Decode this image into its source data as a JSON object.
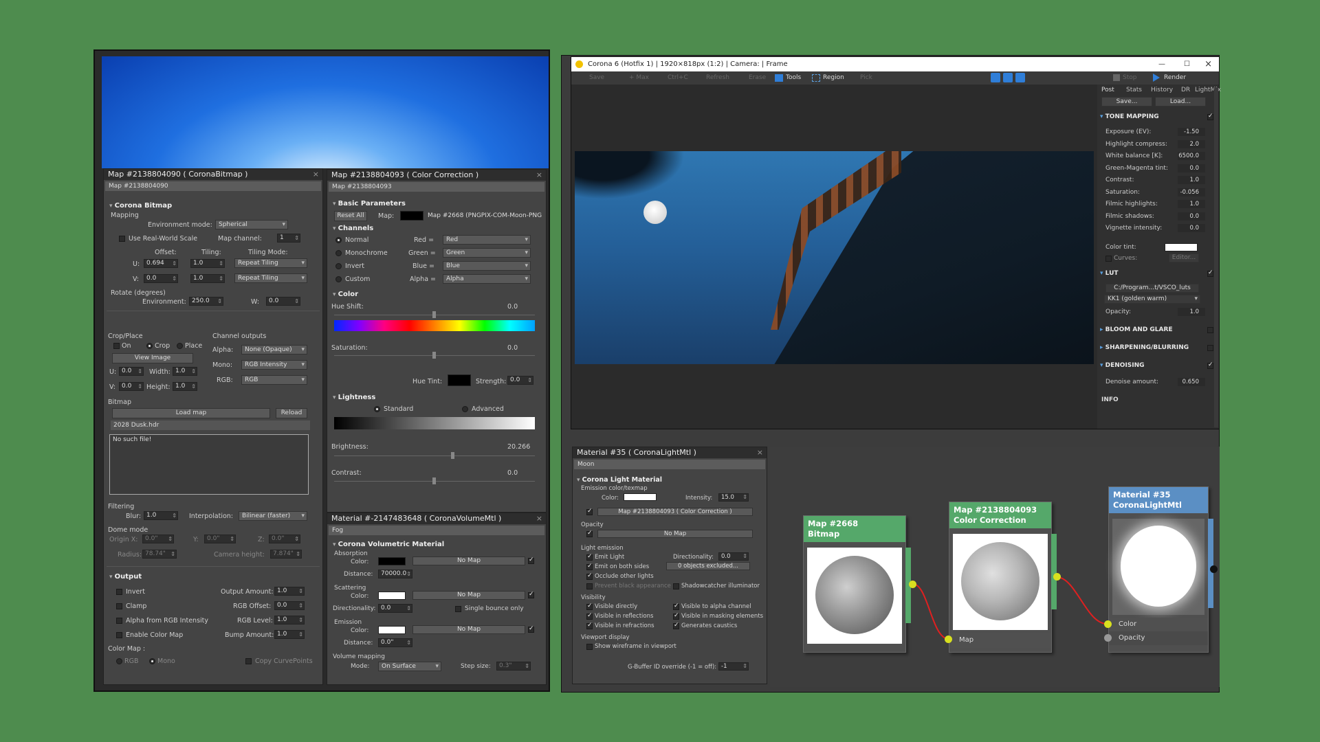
{
  "bitmap_panel": {
    "title": "Map #2138804090  ( CoronaBitmap )",
    "name": "Map #2138804090",
    "section": "Corona Bitmap",
    "mapping_label": "Mapping",
    "env_mode_label": "Environment mode:",
    "env_mode": "Spherical",
    "real_world": "Use Real-World Scale",
    "map_channel_label": "Map channel:",
    "map_channel": "1",
    "offset_label": "Offset:",
    "tiling_label": "Tiling:",
    "tiling_mode_label": "Tiling Mode:",
    "u_label": "U:",
    "u_offset": "0.694",
    "u_tiling": "1.0",
    "u_mode": "Repeat Tiling",
    "v_label": "V:",
    "v_offset": "0.0",
    "v_tiling": "1.0",
    "v_mode": "Repeat Tiling",
    "rotate_label": "Rotate (degrees)",
    "environment_label": "Environment:",
    "environment_val": "250.0",
    "w_label": "W:",
    "w_val": "0.0",
    "crop_label": "Crop/Place",
    "on_label": "On",
    "crop": "Crop",
    "place": "Place",
    "view_image": "View Image",
    "cu_label": "U:",
    "cu": "0.0",
    "width_label": "Width:",
    "width": "1.0",
    "cv_label": "V:",
    "cv": "0.0",
    "height_label": "Height:",
    "height": "1.0",
    "channel_outputs": "Channel outputs",
    "alpha_label": "Alpha:",
    "alpha": "None (Opaque)",
    "mono_label": "Mono:",
    "mono": "RGB Intensity",
    "rgb_label": "RGB:",
    "rgb": "RGB",
    "bitmap_label": "Bitmap",
    "load_map": "Load map",
    "reload": "Reload",
    "file": "2028 Dusk.hdr",
    "no_file": "No such file!",
    "filtering": "Filtering",
    "blur_label": "Blur:",
    "blur": "1.0",
    "interp_label": "Interpolation:",
    "interp": "Bilinear (faster)",
    "dome_label": "Dome mode",
    "origin_label": "Origin X:",
    "origin_x": "0.0\"",
    "y_label": "Y:",
    "origin_y": "0.0\"",
    "z_label": "Z:",
    "origin_z": "0.0\"",
    "radius_label": "Radius:",
    "radius": "78.74\"",
    "cam_label": "Camera height:",
    "cam": "7.874\"",
    "output_section": "Output",
    "invert": "Invert",
    "clamp": "Clamp",
    "alpha_rgb": "Alpha from RGB Intensity",
    "enable_color": "Enable Color Map",
    "out_amount_label": "Output Amount:",
    "out_amount": "1.0",
    "rgb_offset_label": "RGB Offset:",
    "rgb_offset": "0.0",
    "rgb_level_label": "RGB Level:",
    "rgb_level": "1.0",
    "bump_label": "Bump Amount:",
    "bump": "1.0",
    "color_map_label": "Color Map :",
    "rgb_radio": "RGB",
    "mono_radio": "Mono",
    "copy_curve": "Copy CurvePoints"
  },
  "cc_panel": {
    "title": "Map #2138804093  ( Color Correction )",
    "name": "Map #2138804093",
    "basic": "Basic Parameters",
    "reset": "Reset All",
    "map_label": "Map:",
    "map_name": "Map #2668 (PNGPIX-COM-Moon-PNG",
    "channels": "Channels",
    "normal": "Normal",
    "monochrome": "Monochrome",
    "invert": "Invert",
    "custom": "Custom",
    "red_label": "Red =",
    "red": "Red",
    "green_label": "Green =",
    "green": "Green",
    "blue_label": "Blue =",
    "blue": "Blue",
    "alpha_label": "Alpha =",
    "alpha": "Alpha",
    "color": "Color",
    "hue_shift": "Hue Shift:",
    "hue_val": "0.0",
    "saturation": "Saturation:",
    "sat_val": "0.0",
    "hue_tint": "Hue Tint:",
    "strength_label": "Strength:",
    "strength": "0.0",
    "lightness": "Lightness",
    "standard": "Standard",
    "advanced": "Advanced",
    "brightness": "Brightness:",
    "bright_val": "20.266",
    "contrast": "Contrast:",
    "contrast_val": "0.0"
  },
  "vol_panel": {
    "title": "Material #-2147483648  ( CoronaVolumeMtl )",
    "name": "Fog",
    "section": "Corona Volumetric Material",
    "absorption": "Absorption",
    "color_label": "Color:",
    "no_map": "No Map",
    "distance_label": "Distance:",
    "abs_distance": "70000.0",
    "scattering": "Scattering",
    "directionality_label": "Directionality:",
    "directionality": "0.0",
    "single_bounce": "Single bounce only",
    "emission": "Emission",
    "em_distance": "0.0\"",
    "volume_mapping": "Volume mapping",
    "mode_label": "Mode:",
    "mode": "On Surface",
    "step_label": "Step size:",
    "step": "0.3\""
  },
  "vfb": {
    "title": "Corona 6 (Hotfix 1) | 1920×818px (1:2) | Camera: | Frame",
    "toolbar": [
      "Save",
      "+ Max",
      "Ctrl+C",
      "Refresh",
      "Erase",
      "Tools",
      "Region",
      "Pick"
    ],
    "stop": "Stop",
    "render": "Render",
    "tabs": [
      "Post",
      "Stats",
      "History",
      "DR",
      "LightMix"
    ],
    "save": "Save...",
    "load": "Load...",
    "tone_mapping": "TONE MAPPING",
    "tm_rows": [
      {
        "label": "Exposure (EV):",
        "value": "-1.50"
      },
      {
        "label": "Highlight compress:",
        "value": "2.0"
      },
      {
        "label": "White balance [K]:",
        "value": "6500.0"
      },
      {
        "label": "Green-Magenta tint:",
        "value": "0.0"
      },
      {
        "label": "Contrast:",
        "value": "1.0"
      },
      {
        "label": "Saturation:",
        "value": "-0.056"
      },
      {
        "label": "Filmic highlights:",
        "value": "1.0"
      },
      {
        "label": "Filmic shadows:",
        "value": "0.0"
      },
      {
        "label": "Vignette intensity:",
        "value": "0.0"
      }
    ],
    "color_tint": "Color tint:",
    "curves": "Curves:",
    "editor": "Editor...",
    "lut": "LUT",
    "lut_path": "C:/Program...t/VSCO_luts",
    "lut_name": "KK1 (golden warm)",
    "opacity_label": "Opacity:",
    "opacity": "1.0",
    "bloom": "BLOOM AND GLARE",
    "sharpen": "SHARPENING/BLURRING",
    "denoise": "DENOISING",
    "denoise_label": "Denoise amount:",
    "denoise_val": "0.650",
    "info": "INFO"
  },
  "light_panel": {
    "title": "Material #35  ( CoronaLightMtl )",
    "name": "Moon",
    "section": "Corona Light Material",
    "emission_texmap": "Emission color/texmap",
    "color_label": "Color:",
    "intensity_label": "Intensity:",
    "intensity": "15.0",
    "map_btn": "Map #2138804093  ( Color Correction )",
    "opacity": "Opacity",
    "no_map": "No Map",
    "light_emission": "Light emission",
    "emit_light": "Emit Light",
    "directionality_label": "Directionality:",
    "directionality": "0.0",
    "emit_both": "Emit on both sides",
    "excluded": "0 objects excluded...",
    "occlude": "Occlude other lights",
    "shadowcatcher": "Shadowcatcher illuminator",
    "prevent_black": "Prevent black appearance",
    "visibility": "Visibility",
    "vis_direct": "Visible directly",
    "vis_alpha": "Visible to alpha channel",
    "vis_refl": "Visible in reflections",
    "vis_mask": "Visible in masking elements",
    "vis_refr": "Visible in refractions",
    "caustics": "Generates caustics",
    "viewport": "Viewport display",
    "wireframe": "Show wireframe in viewport",
    "gbuffer_label": "G-Buffer ID override (-1 = off):",
    "gbuffer": "-1"
  },
  "nodes": {
    "bitmap_title": "Map #2668",
    "bitmap_sub": "Bitmap",
    "cc_title": "Map #2138804093",
    "cc_sub": "Color Correction",
    "cc_port": "Map",
    "mtl_title": "Material #35",
    "mtl_sub": "CoronaLightMtl",
    "mtl_color": "Color",
    "mtl_opacity": "Opacity"
  },
  "colors": {
    "accent": "#5aa0e0",
    "node_green": "#55a86a",
    "node_blue": "#5b8fc4",
    "socket": "#d8e020",
    "wire": "#e02020"
  }
}
